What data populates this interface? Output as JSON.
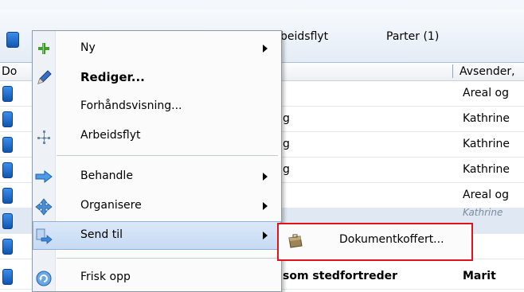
{
  "window": {
    "tabs": [
      {
        "label": "beidsflyt"
      },
      {
        "label": "Parter (1)"
      }
    ],
    "columns": {
      "col_doc": "Do",
      "col_sender": "Avsender,"
    }
  },
  "rows": [
    {
      "title": "",
      "sender": "Areal og"
    },
    {
      "title": "g",
      "sender": "Kathrine"
    },
    {
      "title": "g",
      "sender": "Kathrine"
    },
    {
      "title": "g",
      "sender": "Kathrine"
    },
    {
      "title": "",
      "sender": "Areal og"
    },
    {
      "title": "",
      "sender": "Kathrine"
    },
    {
      "title": "",
      "sender": ""
    },
    {
      "title": "som stedfortreder",
      "sender": "Marit"
    }
  ],
  "context_menu": {
    "items": [
      {
        "label": "Ny",
        "icon": "plus-icon",
        "submenu": true
      },
      {
        "label": "Rediger...",
        "icon": "pencil-icon",
        "submenu": false
      },
      {
        "label": "Forhåndsvisning...",
        "icon": "",
        "submenu": false
      },
      {
        "label": "Arbeidsflyt",
        "icon": "workflow-icon",
        "submenu": false
      },
      {
        "label": "Behandle",
        "icon": "process-arrow-icon",
        "submenu": true
      },
      {
        "label": "Organisere",
        "icon": "move-arrows-icon",
        "submenu": true
      },
      {
        "label": "Send til",
        "icon": "send-to-icon",
        "submenu": true
      },
      {
        "label": "Frisk opp",
        "icon": "refresh-icon",
        "submenu": false
      }
    ]
  },
  "submenu": {
    "items": [
      {
        "label": "Dokumentkoffert...",
        "icon": "briefcase-icon"
      }
    ]
  },
  "colors": {
    "highlight": "#c6daf3",
    "submenu_border": "#e0121b",
    "doc_icon": "#1256b0"
  }
}
